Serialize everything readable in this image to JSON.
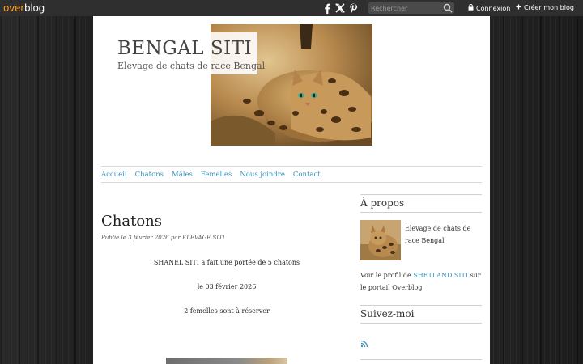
{
  "topbar": {
    "logo_over": "over",
    "logo_blog": "blog",
    "social_icons": [
      "facebook-icon",
      "x-icon",
      "pinterest-icon"
    ],
    "search_placeholder": "Rechercher",
    "login_label": "Connexion",
    "create_label": "Créer mon blog"
  },
  "header": {
    "title": "BENGAL SITI",
    "tagline": "Elevage de chats de race Bengal"
  },
  "nav": {
    "items": [
      "Accueil",
      "Chatons",
      "Mâles",
      "Femelles",
      "Nous joindre",
      "Contact"
    ]
  },
  "post": {
    "title": "Chatons",
    "meta": "Publié le 3 février 2026 par ELEVAGE SITI",
    "lines": [
      "SHANEL SITI a fait une portée de 5 chatons",
      "le 03 février 2026",
      "2 femelles sont à réserver"
    ]
  },
  "sidebar": {
    "about_heading": "À propos",
    "about_text": "Elevage de chats de race Bengal",
    "profile_prefix": "Voir le profil de ",
    "profile_link": "SHETLAND SITI",
    "profile_suffix": " sur le portail Overblog",
    "follow_heading": "Suivez-moi"
  },
  "colors": {
    "accent_link": "#3a8fb7",
    "logo_orange": "#ff9e1b",
    "topbar_bg": "#2f2f2f"
  }
}
